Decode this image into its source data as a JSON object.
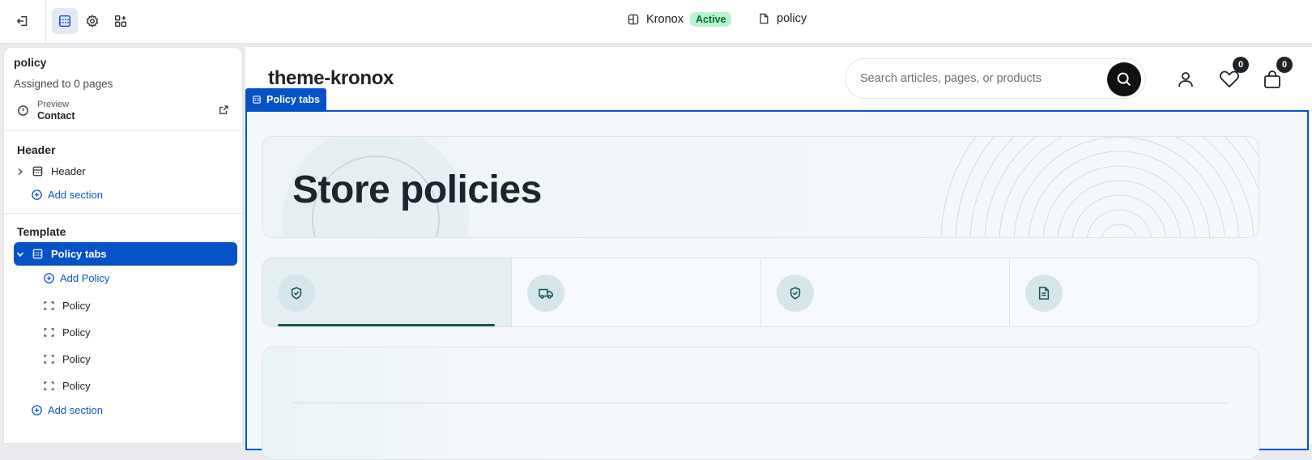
{
  "topbar": {
    "exit_icon": "exit-icon",
    "sections_icon": "sections-icon",
    "settings_icon": "gear-icon",
    "apps_icon": "apps-icon",
    "theme_name": "Kronox",
    "theme_status": "Active",
    "template_name": "policy"
  },
  "left_panel": {
    "title": "policy",
    "subtitle": "Assigned to 0 pages",
    "preview_label": "Preview",
    "preview_value": "Contact",
    "header_group": {
      "heading": "Header",
      "items": [
        {
          "label": "Header"
        }
      ],
      "add_label": "Add section"
    },
    "template_group": {
      "heading": "Template",
      "selected_label": "Policy tabs",
      "add_block_label": "Add Policy",
      "blocks": [
        {
          "label": "Policy"
        },
        {
          "label": "Policy"
        },
        {
          "label": "Policy"
        },
        {
          "label": "Policy"
        }
      ],
      "add_label": "Add section"
    }
  },
  "preview": {
    "logo": "theme-kronox",
    "search_placeholder": "Search articles, pages, or products",
    "wishlist_count": "0",
    "cart_count": "0",
    "section_label": "Policy tabs",
    "hero_title": "Store policies",
    "tabs": [
      {
        "icon": "shield-check-icon",
        "active": true
      },
      {
        "icon": "truck-icon",
        "active": false
      },
      {
        "icon": "shield-check-icon",
        "active": false
      },
      {
        "icon": "document-icon",
        "active": false
      }
    ]
  },
  "colors": {
    "accent": "#0552c6",
    "active_badge_bg": "#b7f3cd",
    "teal": "#17574f"
  }
}
